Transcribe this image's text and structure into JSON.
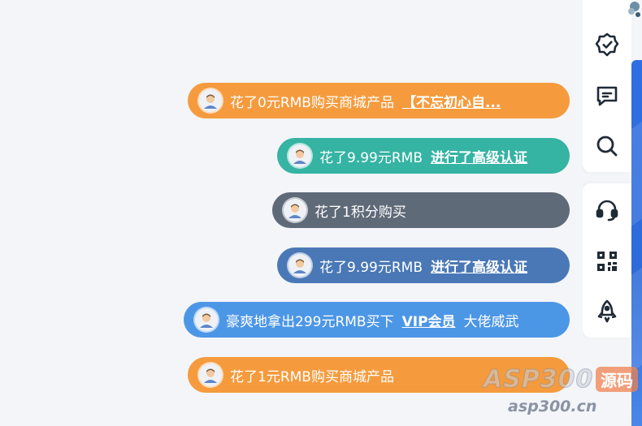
{
  "notifications": [
    {
      "text": "花了0元RMB购买商城产品",
      "link": "【不忘初心自...",
      "after": "",
      "color": "#f59b3d"
    },
    {
      "text": "花了9.99元RMB",
      "link": "进行了高级认证",
      "after": "",
      "color": "#35b3a3"
    },
    {
      "text": "花了1积分购买",
      "link": "",
      "after": "",
      "color": "#5f6a78"
    },
    {
      "text": "花了9.99元RMB",
      "link": "进行了高级认证",
      "after": "",
      "color": "#4a78b6"
    },
    {
      "text": "豪爽地拿出299元RMB买下",
      "link": "VIP会员",
      "after": "大佬威武",
      "color": "#4c96e6"
    },
    {
      "text": "花了1元RMB购买商城产品",
      "link": "",
      "after": "",
      "color": "#f59b3d"
    }
  ],
  "right_panel": {
    "icons": [
      "verified-badge-icon",
      "message-icon",
      "search-icon",
      "headset-icon",
      "qr-code-icon",
      "rocket-icon"
    ],
    "accent": "#2f6fe4"
  },
  "watermark": {
    "brand": "ASP300",
    "badge": "源码",
    "url": "asp300.cn"
  }
}
